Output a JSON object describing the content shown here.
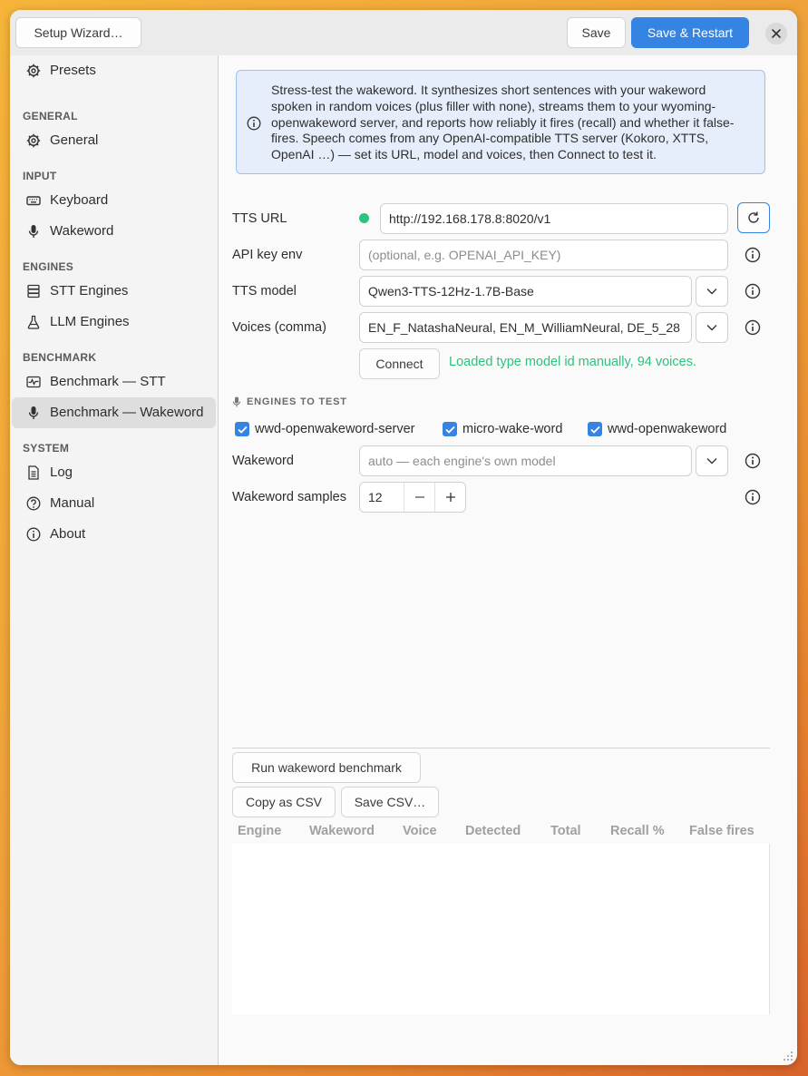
{
  "header": {
    "setup_wizard_label": "Setup Wizard…",
    "save_label": "Save",
    "save_restart_label": "Save & Restart"
  },
  "sidebar": {
    "presets": "Presets",
    "sections": [
      {
        "heading": "GENERAL",
        "items": [
          "General"
        ]
      },
      {
        "heading": "INPUT",
        "items": [
          "Keyboard",
          "Wakeword"
        ]
      },
      {
        "heading": "ENGINES",
        "items": [
          "STT Engines",
          "LLM Engines"
        ]
      },
      {
        "heading": "BENCHMARK",
        "items": [
          "Benchmark — STT",
          "Benchmark — Wakeword"
        ]
      },
      {
        "heading": "SYSTEM",
        "items": [
          "Log",
          "Manual",
          "About"
        ]
      }
    ],
    "active_item": "Benchmark — Wakeword"
  },
  "info": {
    "text": "Stress-test the wakeword. It synthesizes short sentences with your wakeword spoken in random voices (plus filler with none), streams them to your wyoming-openwakeword server, and reports how reliably it fires (recall) and whether it false-fires. Speech comes from any OpenAI-compatible TTS server (Kokoro, XTTS, OpenAI …) — set its URL, model and voices, then Connect to test it."
  },
  "form": {
    "tts_url_label": "TTS URL",
    "tts_url_value": "http://192.168.178.8:8020/v1",
    "api_key_label": "API key env",
    "api_key_placeholder": "(optional, e.g. OPENAI_API_KEY)",
    "tts_model_label": "TTS model",
    "tts_model_value": "Qwen3-TTS-12Hz-1.7B-Base",
    "voices_label": "Voices (comma)",
    "voices_value": "EN_F_NatashaNeural, EN_M_WilliamNeural, DE_5_28",
    "connect_label": "Connect",
    "connect_status": "Loaded type model id manually, 94 voices.",
    "engines_heading": "ENGINES TO TEST",
    "engines": [
      "wwd-openwakeword-server",
      "micro-wake-word",
      "wwd-openwakeword"
    ],
    "wakeword_label": "Wakeword",
    "wakeword_placeholder": "auto — each engine's own model",
    "samples_label": "Wakeword samples",
    "samples_value": "12",
    "status_color": "#2ec27e"
  },
  "actions": {
    "run_label": "Run wakeword benchmark",
    "copy_csv_label": "Copy as CSV",
    "save_csv_label": "Save CSV…"
  },
  "table": {
    "columns": [
      "Engine",
      "Wakeword",
      "Voice",
      "Detected",
      "Total",
      "Recall %",
      "False fires"
    ],
    "rows": []
  },
  "colors": {
    "accent": "#3584e4",
    "success": "#2ec27e"
  }
}
